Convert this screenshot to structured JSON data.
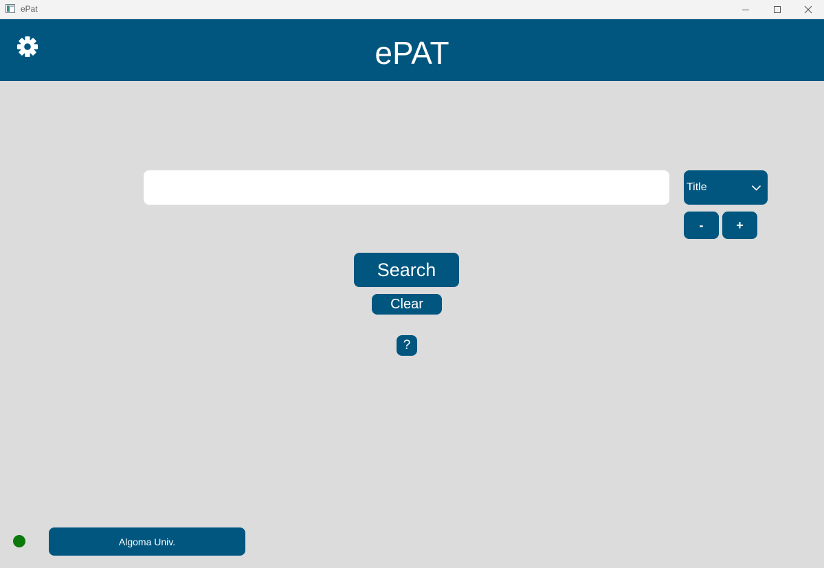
{
  "window": {
    "title": "ePat",
    "icon": "app-window-icon",
    "controls": [
      "minimize",
      "maximize",
      "close"
    ]
  },
  "header": {
    "title": "ePAT",
    "settings_icon": "gear-icon"
  },
  "search": {
    "value": "",
    "placeholder": "",
    "field_selected": "Title",
    "minus_label": "-",
    "plus_label": "+",
    "search_label": "Search",
    "clear_label": "Clear",
    "help_label": "?"
  },
  "footer": {
    "status": "connected",
    "server_label": "Algoma Univ."
  },
  "colors": {
    "primary": "#00567f",
    "background": "#dcdcdc",
    "status_ok": "#0b7a0b"
  }
}
